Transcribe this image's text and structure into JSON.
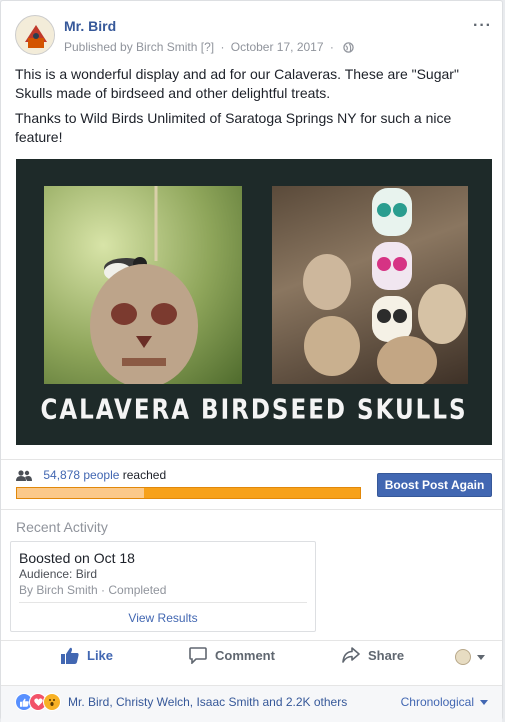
{
  "post": {
    "page_name": "Mr. Bird",
    "published_by": "Published by Birch Smith",
    "help_marker": "[?]",
    "date": "October 17, 2017",
    "more": "···",
    "text_p1": "This is a wonderful display and ad for our Calaveras. These are \"Sugar\" Skulls made of birdseed and other delightful treats.",
    "text_p2": "Thanks to Wild Birds Unlimited of Saratoga Springs NY for such a nice feature!",
    "image_caption": "CALAVERA BIRDSEED SKULLS"
  },
  "reach": {
    "count": "54,878 people",
    "label": "reached",
    "organic_fraction": 0.37,
    "colors": {
      "organic": "#fbc98a",
      "paid": "#f7a11a"
    }
  },
  "boost_button": "Boost Post Again",
  "recent_activity": {
    "title": "Recent Activity",
    "item_title": "Boosted on Oct 18",
    "audience": "Audience: Bird",
    "by": "By Birch Smith",
    "status": "Completed",
    "link": "View Results"
  },
  "actions": {
    "like": "Like",
    "comment": "Comment",
    "share": "Share"
  },
  "reactions": {
    "names": "Mr. Bird, Christy Welch, Isaac Smith and 2.2K others",
    "sort": "Chronological"
  },
  "colors": {
    "brand": "#4267b2",
    "link": "#365899"
  }
}
